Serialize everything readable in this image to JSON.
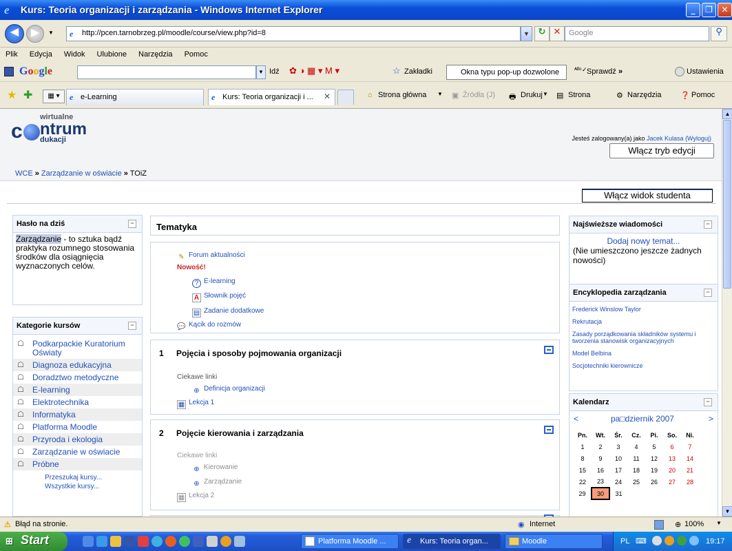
{
  "window": {
    "title": "Kurs: Teoria organizacji i zarządzania - Windows Internet Explorer",
    "minimize": "_",
    "maximize": "❐",
    "close": "✕"
  },
  "address": {
    "url": "http://pcen.tarnobrzeg.pl/moodle/course/view.php?id=8",
    "search_placeholder": "Google"
  },
  "menu": [
    "Plik",
    "Edycja",
    "Widok",
    "Ulubione",
    "Narzędzia",
    "Pomoc"
  ],
  "google_toolbar": {
    "logo": "Google",
    "go": "Idź",
    "bookmarks": "Zakładki",
    "popups": "Okna typu pop-up dozwolone",
    "spell": "Sprawdź",
    "more": "»",
    "settings": "Ustawienia"
  },
  "tabs": [
    {
      "label": "e-Learning"
    },
    {
      "label": "Kurs: Teoria organizacji i ...",
      "close": "✕"
    }
  ],
  "commands": {
    "home": "Strona główna",
    "feeds": "Źródła (J)",
    "print": "Drukuj",
    "page": "Strona",
    "tools": "Narzędzia",
    "help": "Pomoc"
  },
  "logo": {
    "top": "wirtualne",
    "c": "c",
    "ntrum": "ntrum",
    "bottom": "dukacji"
  },
  "header": {
    "login_prefix": "Jesteś zalogowany(a) jako",
    "user": "Jacek Kulasa",
    "logout": "(Wyloguj)",
    "edit_button": "Włącz tryb edycji",
    "student_view_button": "Włącz widok studenta"
  },
  "breadcrumb": {
    "root": "WCE",
    "sep": "»",
    "category": "Zarządzanie w oświacie",
    "current": "TOiZ"
  },
  "haslo": {
    "title": "Hasło na dziś",
    "term": "Zarządzanie",
    "text": " - to sztuka bądź praktyka rozumnego stosowania środków dla osiągnięcia wyznaczonych celów."
  },
  "categories": {
    "title": "Kategorie kursów",
    "items": [
      "Podkarpackie Kuratorium Oświaty",
      "Diagnoza edukacyjna",
      "Doradztwo metodyczne",
      "E-learning",
      "Elektrotechnika",
      "Informatyka",
      "Platforma Moodle",
      "Przyroda i ekologia",
      "Zarządzanie w oświacie",
      "Próbne"
    ],
    "search": "Przeszukaj kursy...",
    "all": "Wszystkie kursy..."
  },
  "main": {
    "title": "Tematyka",
    "section0": {
      "forum": "Forum aktualności",
      "new_label": "Nowość!",
      "elearning": "E-learning",
      "glossary": "Słownik pojęć",
      "assignment": "Zadanie dodatkowe",
      "chat": "Kącik do rozmów"
    },
    "topics": [
      {
        "num": "1",
        "title": "Pojęcia i sposoby pojmowania organizacji",
        "label": "Ciekawe linki",
        "links": [
          "Definicja organizacji"
        ],
        "lesson": "Lekcja 1"
      },
      {
        "num": "2",
        "title": "Pojęcie kierowania i zarządzania",
        "label": "Ciekawe linki",
        "links": [
          "Kierowanie",
          "Zarządzanie"
        ],
        "lesson": "Lekcja 2"
      }
    ]
  },
  "news": {
    "title": "Najświeższe wiadomości",
    "add": "Dodaj nowy temat...",
    "empty": "(Nie umieszczono jeszcze żadnych nowości)"
  },
  "encyclopedia": {
    "title": "Encyklopedia zarządzania",
    "items": [
      "Frederick Winslow Taylor",
      "Rekrutacja",
      "Zasady porządkowania składników systemu i tworzenia stanowisk organizacyjnych",
      "Model Belbina",
      "Socjotechniki kierownicze"
    ]
  },
  "calendar": {
    "title": "Kalendarz",
    "prev": "<",
    "next": ">",
    "month": "pa□dziernik 2007",
    "days": [
      "Pn.",
      "Wt.",
      "Śr.",
      "Cz.",
      "Pi.",
      "So.",
      "Ni."
    ],
    "weeks": [
      [
        "1",
        "2",
        "3",
        "4",
        "5",
        "6",
        "7"
      ],
      [
        "8",
        "9",
        "10",
        "11",
        "12",
        "13",
        "14"
      ],
      [
        "15",
        "16",
        "17",
        "18",
        "19",
        "20",
        "21"
      ],
      [
        "22",
        "23",
        "24",
        "25",
        "26",
        "27",
        "28"
      ],
      [
        "29",
        "30",
        "31",
        "",
        "",
        "",
        ""
      ]
    ],
    "today": "30"
  },
  "status": {
    "error": "Błąd na stronie.",
    "zone": "Internet",
    "zoom": "100%"
  },
  "taskbar": {
    "start": "Start",
    "tasks": [
      "Platforma Moodle ...",
      "Kurs: Teoria organ...",
      "Moodle"
    ],
    "lang": "PL",
    "time": "19:17"
  }
}
